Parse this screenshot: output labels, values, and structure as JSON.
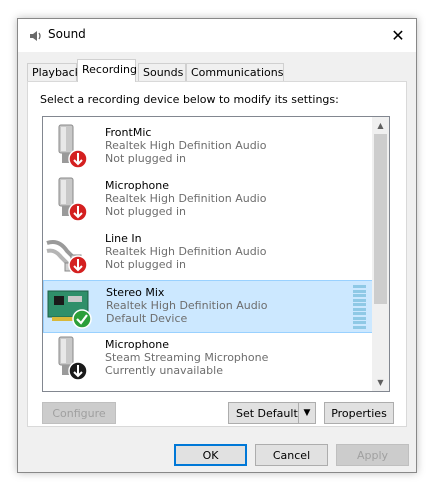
{
  "window": {
    "title": "Sound",
    "close_glyph": "✕"
  },
  "tabs": [
    {
      "label": "Playback"
    },
    {
      "label": "Recording"
    },
    {
      "label": "Sounds"
    },
    {
      "label": "Communications"
    }
  ],
  "instruction": "Select a recording device below to modify its settings:",
  "devices": [
    {
      "name": "FrontMic",
      "driver": "Realtek High Definition Audio",
      "status": "Not plugged in",
      "icon": "microphone-icon",
      "badge": "red-down-arrow"
    },
    {
      "name": "Microphone",
      "driver": "Realtek High Definition Audio",
      "status": "Not plugged in",
      "icon": "microphone-icon",
      "badge": "red-down-arrow"
    },
    {
      "name": "Line In",
      "driver": "Realtek High Definition Audio",
      "status": "Not plugged in",
      "icon": "line-in-cable-icon",
      "badge": "red-down-arrow"
    },
    {
      "name": "Stereo Mix",
      "driver": "Realtek High Definition Audio",
      "status": "Default Device",
      "icon": "sound-card-icon",
      "badge": "green-check"
    },
    {
      "name": "Microphone",
      "driver": "Steam Streaming Microphone",
      "status": "Currently unavailable",
      "icon": "microphone-icon",
      "badge": "black-down-arrow"
    }
  ],
  "buttons": {
    "configure": "Configure",
    "set_default": "Set Default",
    "properties": "Properties",
    "ok": "OK",
    "cancel": "Cancel",
    "apply": "Apply"
  },
  "colors": {
    "selection": "#cce8ff",
    "accent": "#0078d7",
    "level": "#8fc9e6"
  }
}
